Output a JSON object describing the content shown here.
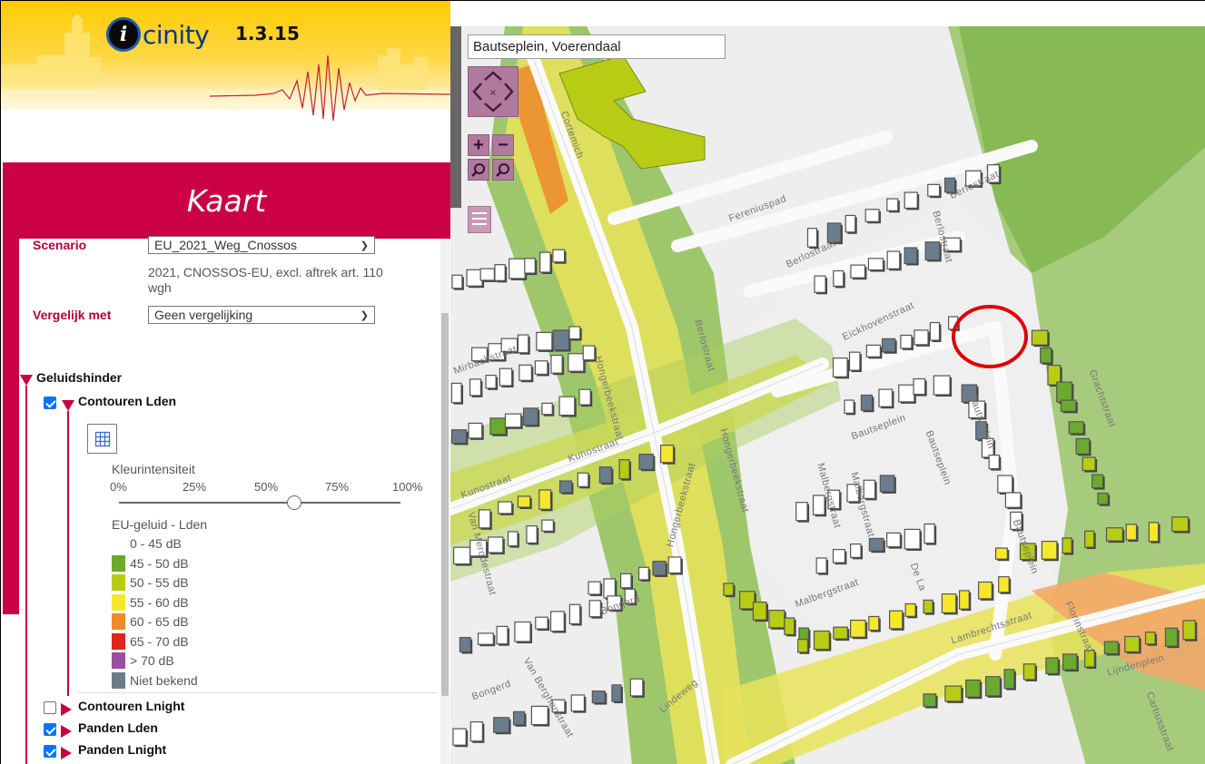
{
  "app": {
    "logo_letter": "i",
    "logo_text": "cinity",
    "version": "1.3.15",
    "panel_title": "Kaart"
  },
  "scenario": {
    "label": "Scenario",
    "selected": "EU_2021_Weg_Cnossos",
    "description_line1": "2021, CNOSSOS-EU, excl. aftrek art. 110",
    "description_line2": "wgh"
  },
  "compare": {
    "label": "Vergelijk met",
    "selected": "Geen vergelijking"
  },
  "tree": {
    "root_label": "Geluidshinder",
    "contouren_lden": {
      "label": "Contouren Lden",
      "checked": true,
      "expanded": true
    },
    "contouren_lnight": {
      "label": "Contouren Lnight",
      "checked": false,
      "expanded": false
    },
    "panden_lden": {
      "label": "Panden Lden",
      "checked": true,
      "expanded": false
    },
    "panden_lnight": {
      "label": "Panden Lnight",
      "checked": true,
      "expanded": false
    }
  },
  "intensity": {
    "label": "Kleurintensiteit",
    "ticks": [
      "0%",
      "25%",
      "50%",
      "75%",
      "100%"
    ],
    "value": 0.6
  },
  "legend": {
    "title": "EU-geluid - Lden",
    "items": [
      {
        "label": "0 - 45 dB",
        "color": ""
      },
      {
        "label": "45 - 50 dB",
        "color": "#6aaa2e"
      },
      {
        "label": "50 - 55 dB",
        "color": "#b9cc14"
      },
      {
        "label": "55 - 60 dB",
        "color": "#f5e82a"
      },
      {
        "label": "60 - 65 dB",
        "color": "#ee8a2c"
      },
      {
        "label": "65 - 70 dB",
        "color": "#e0241e"
      },
      {
        "label": "> 70 dB",
        "color": "#9a4ea0"
      },
      {
        "label": "Niet bekend",
        "color": "#6b7d8c"
      }
    ]
  },
  "map": {
    "search_value": "Bautseplein, Voerendaal",
    "zoom_in": "+",
    "zoom_out": "−",
    "street_labels": {
      "hongerbeekstraat": "Hongerbeekstraat",
      "kunostraat": "Kunostraat",
      "berlostraat": "Berlostraat",
      "eickhovenstraat": "Eickhovenstraat",
      "bautseplein": "Bautseplein",
      "gachtstraat": "Grachtstraat",
      "mirbachstraat": "Mirbachstraat",
      "malbergstraat": "Malbergstraat",
      "lambrechtsstraat": "Lambrechtsstraat",
      "florinstraat": "Florinstraat",
      "lijndenplein": "Lijndenplein",
      "bongerd": "Bongerd",
      "van_merodestraat": "Van Merodestraat",
      "van_berghenstraat": "Van Berghenstraat",
      "lindeweg": "Lindeweg",
      "cortemich": "Cortemich",
      "fereniuspad": "Fereniuspad",
      "cartiusstraat": "Cartiusstraat",
      "de_laar": "De La"
    }
  }
}
